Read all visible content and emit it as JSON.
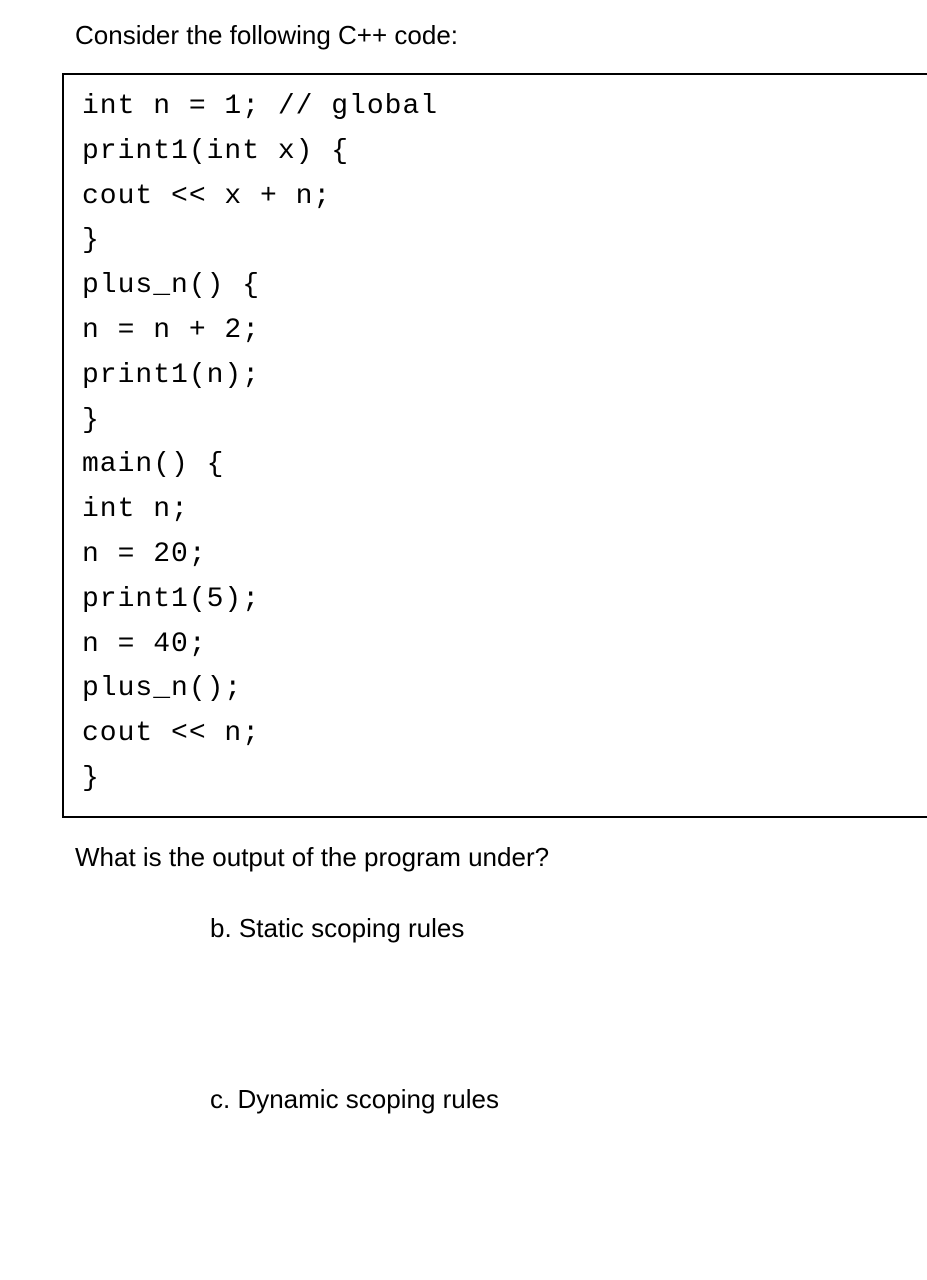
{
  "intro": "Consider the following C++ code:",
  "code": {
    "lines": [
      "int n = 1; // global",
      "print1(int x) {",
      "cout << x + n;",
      "}",
      "plus_n() {",
      "n = n + 2;",
      "print1(n);",
      "}",
      "main() {",
      "int n;",
      "n = 20;",
      "print1(5);",
      "n = 40;",
      "plus_n();",
      "cout << n;",
      "}"
    ]
  },
  "question": "What is the output of the program under?",
  "options": {
    "b": "b. Static scoping rules",
    "c": "c. Dynamic scoping rules"
  }
}
